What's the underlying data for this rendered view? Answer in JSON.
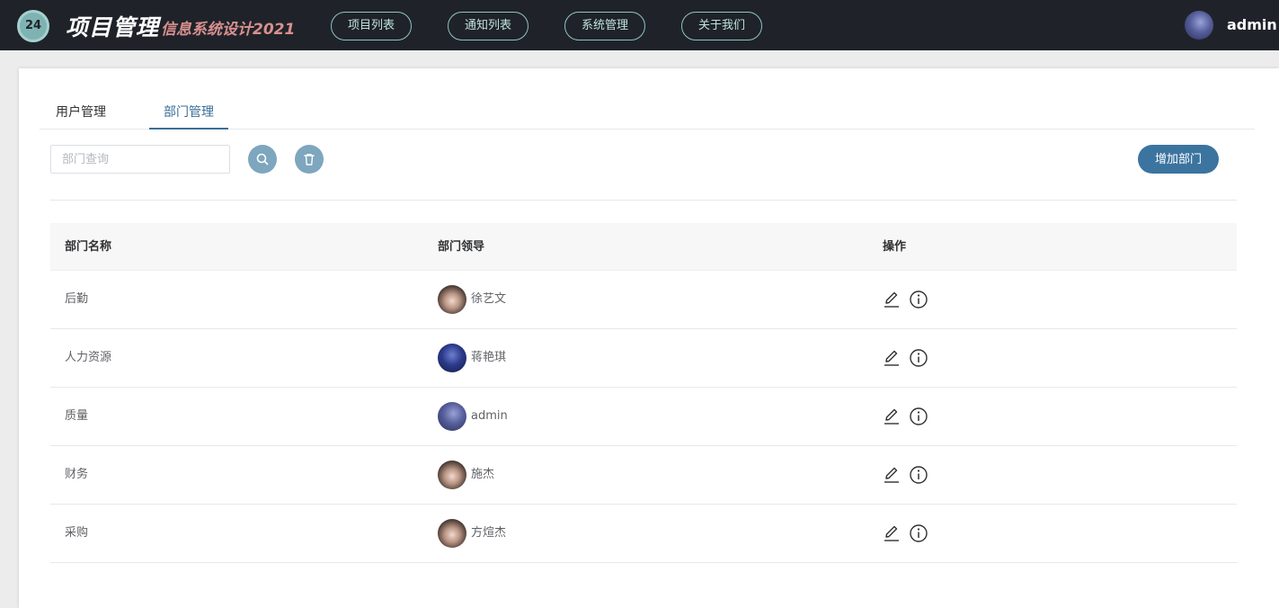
{
  "header": {
    "logo_text": "24",
    "title": "项目管理",
    "subtitle": "信息系统设计2021",
    "nav": [
      {
        "label": "项目列表"
      },
      {
        "label": "通知列表"
      },
      {
        "label": "系统管理"
      },
      {
        "label": "关于我们"
      }
    ],
    "user": {
      "name": "admin"
    }
  },
  "tabs": [
    {
      "label": "用户管理",
      "active": false
    },
    {
      "label": "部门管理",
      "active": true
    }
  ],
  "toolbar": {
    "search_placeholder": "部门查询",
    "search_value": "",
    "search_icon": "search-icon",
    "delete_icon": "trash-icon",
    "add_label": "增加部门"
  },
  "table": {
    "columns": [
      "部门名称",
      "部门领导",
      "操作"
    ],
    "rows": [
      {
        "department": "后勤",
        "leader": "徐艺文"
      },
      {
        "department": "人力资源",
        "leader": "蒋艳琪"
      },
      {
        "department": "质量",
        "leader": "admin"
      },
      {
        "department": "财务",
        "leader": "施杰"
      },
      {
        "department": "采购",
        "leader": "方煊杰"
      }
    ],
    "row_actions": [
      "edit-icon",
      "info-icon"
    ]
  },
  "colors": {
    "topbar": "#1f2329",
    "accent": "#3c74a0",
    "nav_border": "#8fc5c1",
    "subtitle": "#d98f8f"
  }
}
